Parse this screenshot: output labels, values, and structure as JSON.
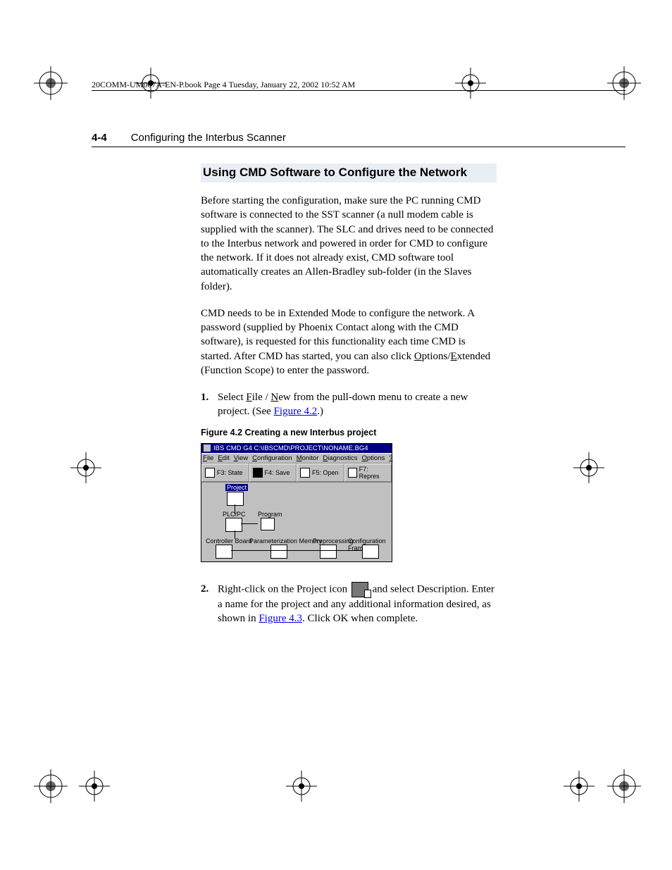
{
  "bookline": "20COMM-UM007A-EN-P.book  Page 4  Tuesday, January 22, 2002  10:52 AM",
  "header": {
    "pagenum": "4-4",
    "chapter": "Configuring the Interbus Scanner"
  },
  "section_title": "Using CMD Software to Configure the Network",
  "para1": "Before starting the configuration, make sure the PC running CMD software is connected to the SST scanner (a null modem cable is supplied with the scanner). The SLC and drives need to be connected to the Interbus network and powered in order for CMD to configure the network. If it does not already exist, CMD software tool automatically creates an Allen-Bradley sub-folder (in the Slaves folder).",
  "para2_a": "CMD needs to be in Extended Mode to configure the network. A password (supplied by Phoenix Contact along with the CMD software), is requested for this functionality each time CMD is started. After CMD has started, you can also click ",
  "para2_opt": "O",
  "para2_b": "ptions/",
  "para2_ext": "E",
  "para2_c": "xtended (Function Scope) to enter the password.",
  "step1_a": "Select ",
  "step1_file": "F",
  "step1_b": "ile / ",
  "step1_new": "N",
  "step1_c": "ew from the pull-down menu to create a new project. (See ",
  "step1_link": "Figure 4.2",
  "step1_d": ".)",
  "fig_caption": "Figure 4.2   Creating a new Interbus project",
  "fig": {
    "title": "IBS CMD G4 C:\\IBSCMD\\PROJECT\\NONAME.BG4",
    "menu": [
      "File",
      "Edit",
      "View",
      "Configuration",
      "Monitor",
      "Diagnostics",
      "Options",
      "?"
    ],
    "toolbar": [
      {
        "key": "F3",
        "label": "State"
      },
      {
        "key": "F4",
        "label": "Save"
      },
      {
        "key": "F5",
        "label": "Open"
      },
      {
        "key": "F7",
        "label": "Repres"
      }
    ],
    "nodes": {
      "project": "Project",
      "plcpc": "PLC/PC",
      "program": "Program",
      "ctrlboard": "Controller Board",
      "parammem": "Parameterization Memory",
      "preproc": "Preprocessing",
      "cfgframe": "Configuration Frame"
    }
  },
  "step2_a": "Right-click on the Project icon ",
  "step2_b": " and select Description. Enter a name for the project and any additional information desired, as shown in ",
  "step2_link": "Figure 4.3",
  "step2_c": ". Click OK when complete."
}
